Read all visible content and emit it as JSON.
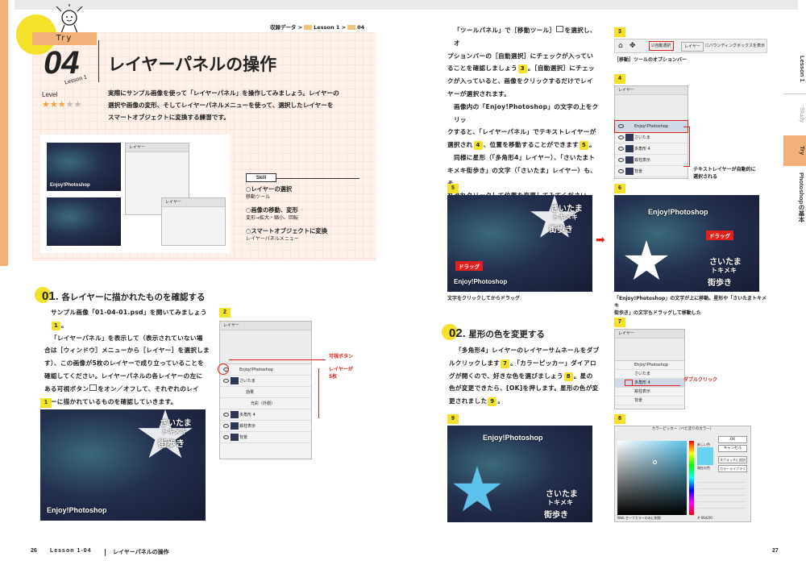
{
  "breadcrumb": {
    "part1": "収録データ >",
    "part2": "Lesson 1 >",
    "part3": "04"
  },
  "header": {
    "try_label": "Try",
    "lesson_num": "04",
    "lesson_sub": "Lesson 1",
    "title": "レイヤーパネルの操作",
    "level_label": "Level",
    "stars_on": "★★★",
    "stars_off": "★★"
  },
  "intro": {
    "line1": "実際にサンプル画像を使って「レイヤーパネル」を操作してみましょう。レイヤーの",
    "line2": "選択や画像の変形、そしてレイヤーパネルメニューを使って、選択したレイヤーを",
    "line3": "スマートオブジェクトに変換する練習です。"
  },
  "skill": {
    "tag": "Skill",
    "items": [
      {
        "title": "○レイヤーの選択",
        "sub": "移動ツール"
      },
      {
        "title": "○画像の移動、変形",
        "sub": "変形→拡大・縮小、回転"
      },
      {
        "title": "○スマートオブジェクトに変換",
        "sub": "レイヤーパネルメニュー"
      }
    ]
  },
  "section1": {
    "num": "01",
    "title": ". 各レイヤーに描かれたものを確認する",
    "lines": [
      "サンプル画像「01-04-01.psd」を開いてみましょう",
      "「レイヤーパネル」を表示して（表示されていない場",
      "合は［ウィンドウ］メニューから［レイヤー］を選択しま",
      "す）、この画像が5枚のレイヤーで成り立っていることを",
      "確認してください。レイヤーパネルの各レイヤーの左に",
      "ある可視ボタン",
      "をオン／オフして、それぞれのレイ",
      "ヤーに描かれているものを確認していきます。"
    ],
    "step1": "1",
    "period": "。"
  },
  "section2": {
    "num": "02",
    "title": ". 星形の色を変更する",
    "lines": [
      "「多角形4」レイヤーのレイヤーサムネールをダブ",
      "ルクリックします",
      "。「カラーピッカー」ダイアロ",
      "グが開くので、好きな色を選びましょう",
      "。星の",
      "色が変更できたら、[OK]を押します。星形の色が変",
      "更されました"
    ],
    "step7": "7",
    "step8": "8",
    "step9": "9",
    "period": "。"
  },
  "right_text": {
    "lines": [
      "「ツールパネル」で［移動ツール］",
      "を選択し、オ",
      "プションバーの［自動選択］にチェックが入ってい",
      "ることを確認しましょう",
      "。［自動選択］にチェッ",
      "クが入っていると、画像をクリックするだけでレイ",
      "ヤーが選択されます。",
      "画像内の「Enjoy!Photoshop」の文字の上をクリッ",
      "クすると、「レイヤーパネル」でテキストレイヤーが",
      "選択され",
      "、位置を移動することができます",
      "同様に星形（「多角形4」レイヤー）、「さいたまト",
      "キメキ街歩き」の文字（「さいたま」レイヤー）も、そ",
      "れぞれクリックして位置を変更してみてください",
      "。"
    ],
    "step3": "3",
    "step4": "4",
    "step5": "5",
    "step6": "6",
    "period": "。"
  },
  "figures": {
    "f1": "1",
    "f2": "2",
    "f3": "3",
    "f4": "4",
    "f5": "5",
    "f6": "6",
    "f7": "7",
    "f8": "8",
    "f9": "9",
    "cap3": "［移動］ツールのオプションバー",
    "cap4": "テキストレイヤーが自動的に選択される",
    "cap5": "文字をクリックしてからドラッグ",
    "cap6a": "「Enjoy!Photoshop」の文字が上に移動。星形や「さいたまトキメキ",
    "cap6b": "街歩き」の文字もドラッグして移動した",
    "visible_btn": "可視ボタン",
    "layer_count1": "レイヤーが",
    "layer_count2": "5枚",
    "drag": "ドラッグ",
    "dblclick": "ダブルクリック",
    "photo_text": "Enjoy!Photoshop",
    "saitama1": "さいたま",
    "saitama2": "トキメキ",
    "saitama3": "街歩き",
    "layers_title": "レイヤー",
    "layer_rows": [
      "Enjoy!Photoshop",
      "さいたま",
      "効果",
      "光彩（外側）",
      "多角形 4",
      "鉄柱表示",
      "背景"
    ],
    "options_auto": "自動選択",
    "options_layer": "レイヤー",
    "options_bbox": "バウンディングボックスを表示",
    "picker_title": "カラーピッカー（べた塗りのカラー）",
    "picker_ok": "OK",
    "picker_cancel": "キャンセル",
    "picker_swatch": "スウォッチに追加",
    "picker_lib": "カラーライブラリ",
    "picker_new": "新しい色",
    "picker_cur": "現在の色",
    "picker_web": "Web セーフカラーのみに制限",
    "picker_hex": "# 69d2f0"
  },
  "vtabs": {
    "lesson": "Lesson 1",
    "study": "Study",
    "try": "Try",
    "basics": "Photoshopの基本"
  },
  "footer": {
    "left_page": "26",
    "left_text": "Lesson 1-04",
    "left_title": "レイヤーパネルの操作",
    "right_page": "27"
  },
  "colors": {
    "accent_yellow": "#f4e22a",
    "accent_orange": "#f1b178",
    "red": "#e0201c",
    "star_blue": "#5bc3eb"
  }
}
